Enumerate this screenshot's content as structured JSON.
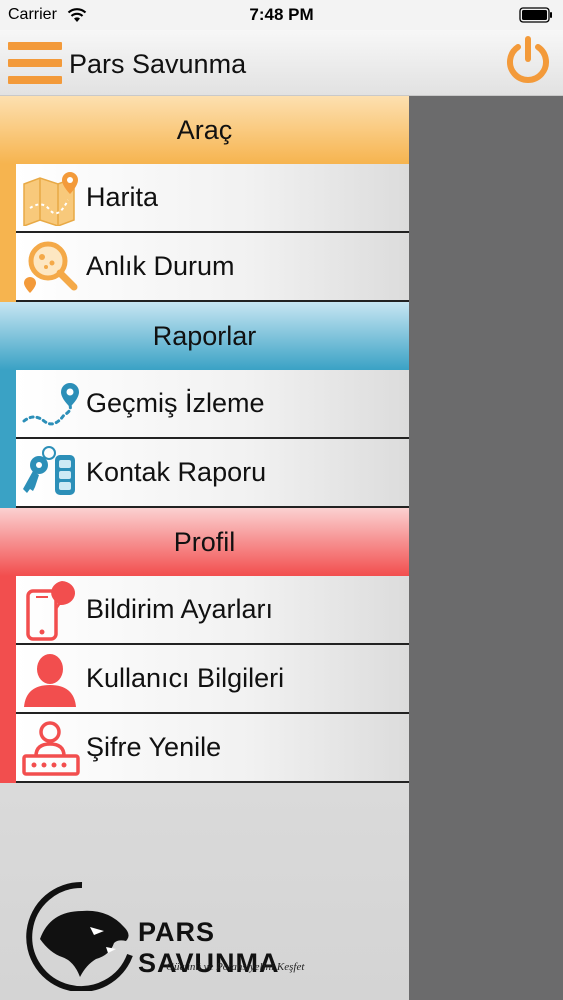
{
  "status_bar": {
    "carrier": "Carrier",
    "time": "7:48 PM"
  },
  "nav": {
    "title": "Pars Savunma"
  },
  "drawer": {
    "sections": [
      {
        "title": "Araç",
        "color": "#f6b44f",
        "items": [
          {
            "label": "Harita",
            "icon": "map-icon"
          },
          {
            "label": "Anlık Durum",
            "icon": "search-location-icon"
          }
        ]
      },
      {
        "title": "Raporlar",
        "color": "#3aa2c5",
        "items": [
          {
            "label": "Geçmiş İzleme",
            "icon": "route-history-icon"
          },
          {
            "label": "Kontak Raporu",
            "icon": "car-key-icon"
          }
        ]
      },
      {
        "title": "Profil",
        "color": "#f24e4e",
        "items": [
          {
            "label": "Bildirim Ayarları",
            "icon": "phone-notification-icon"
          },
          {
            "label": "Kullanıcı Bilgileri",
            "icon": "user-icon"
          },
          {
            "label": "Şifre Yenile",
            "icon": "password-reset-icon"
          }
        ]
      }
    ]
  },
  "logo": {
    "brand": "PARS SAVUNMA",
    "slogan": "Gücünü ve Potansiyelini Keşfet"
  },
  "colors": {
    "accent_orange": "#f39a3a",
    "panel_gray": "#6b6b6c"
  }
}
